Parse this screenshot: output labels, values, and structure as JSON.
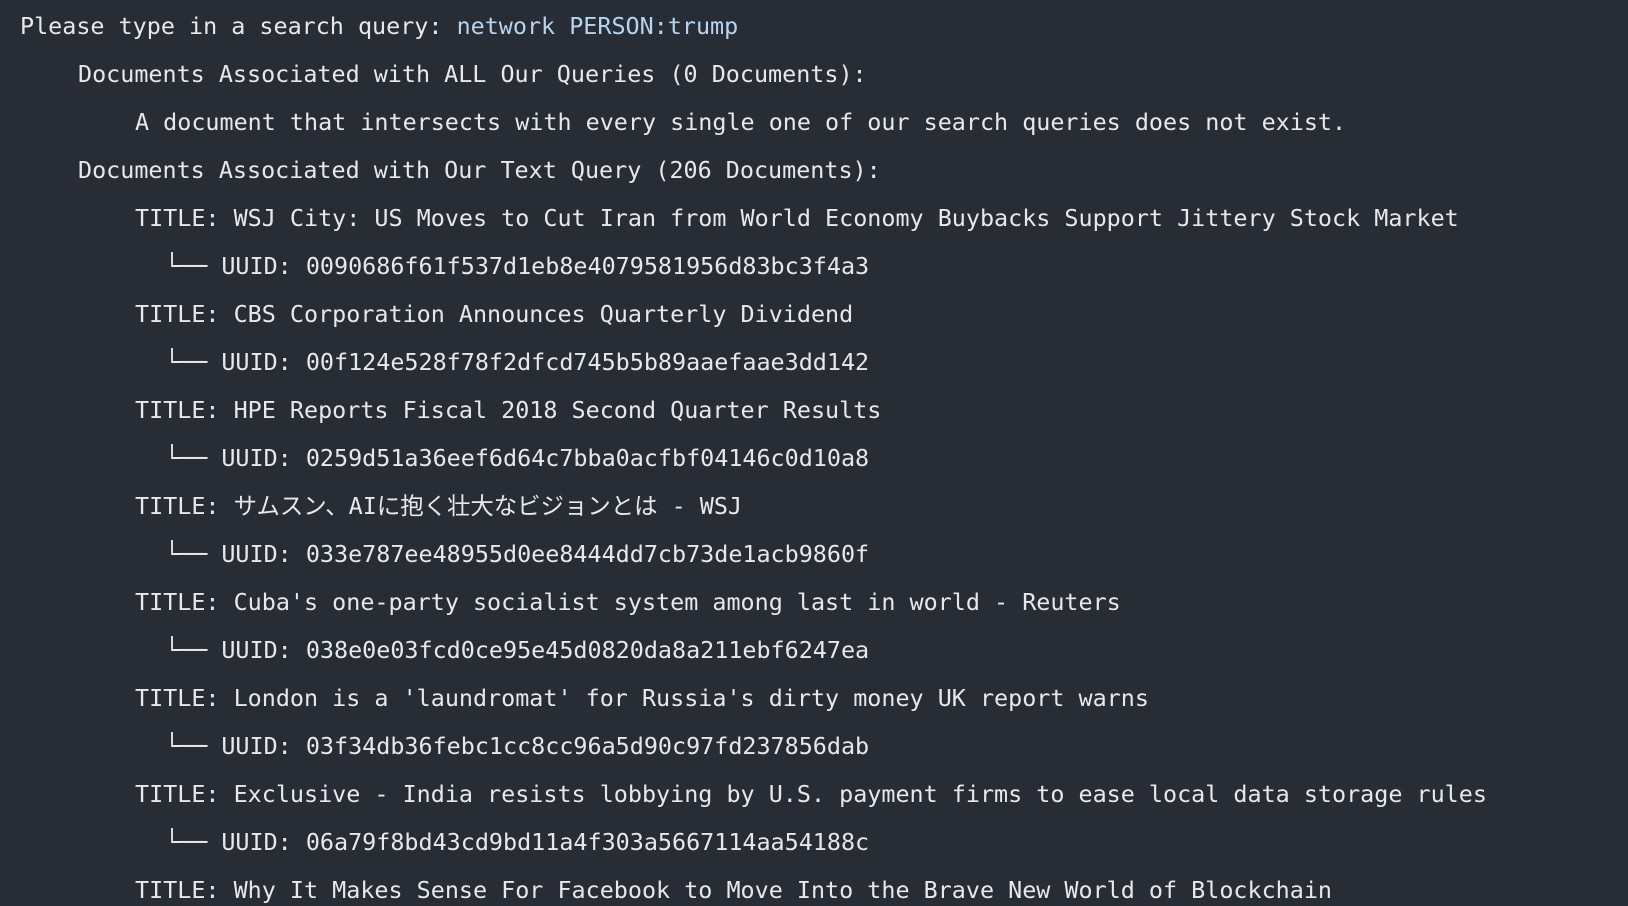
{
  "prompt": {
    "label": "Please type in a search query: ",
    "query": "network PERSON:trump"
  },
  "all_queries": {
    "heading": "Documents Associated with ALL Our Queries (0 Documents):",
    "message": "A document that intersects with every single one of our search queries does not exist."
  },
  "text_query": {
    "heading": "Documents Associated with Our Text Query (206 Documents):",
    "title_prefix": "TITLE: ",
    "uuid_prefix": "UUID: ",
    "branch": "└── ",
    "documents": [
      {
        "title": "WSJ City: US Moves to Cut Iran from World Economy Buybacks Support Jittery Stock Market\u0001",
        "uuid": "0090686f61f537d1eb8e4079581956d83bc3f4a3"
      },
      {
        "title": "CBS Corporation Announces Quarterly Dividend",
        "uuid": "00f124e528f78f2dfcd745b5b89aaefaae3dd142"
      },
      {
        "title": "HPE Reports Fiscal 2018 Second Quarter Results",
        "uuid": "0259d51a36eef6d64c7bba0acfbf04146c0d10a8"
      },
      {
        "title": "サムスン、AIに抱く壮大なビジョンとは - WSJ",
        "uuid": "033e787ee48955d0ee8444dd7cb73de1acb9860f"
      },
      {
        "title": "Cuba's one-party socialist system among last in world - Reuters",
        "uuid": "038e0e03fcd0ce95e45d0820da8a211ebf6247ea"
      },
      {
        "title": "London is a 'laundromat' for Russia's dirty money UK report warns\u0001",
        "uuid": "03f34db36febc1cc8cc96a5d90c97fd237856dab"
      },
      {
        "title": "Exclusive - India resists lobbying by U.S. payment firms to ease local data storage rules",
        "uuid": "06a79f8bd43cd9bd11a4f303a5667114aa54188c"
      },
      {
        "title": "Why It Makes Sense For Facebook to Move Into the Brave New World of Blockchain",
        "uuid": ""
      }
    ]
  }
}
